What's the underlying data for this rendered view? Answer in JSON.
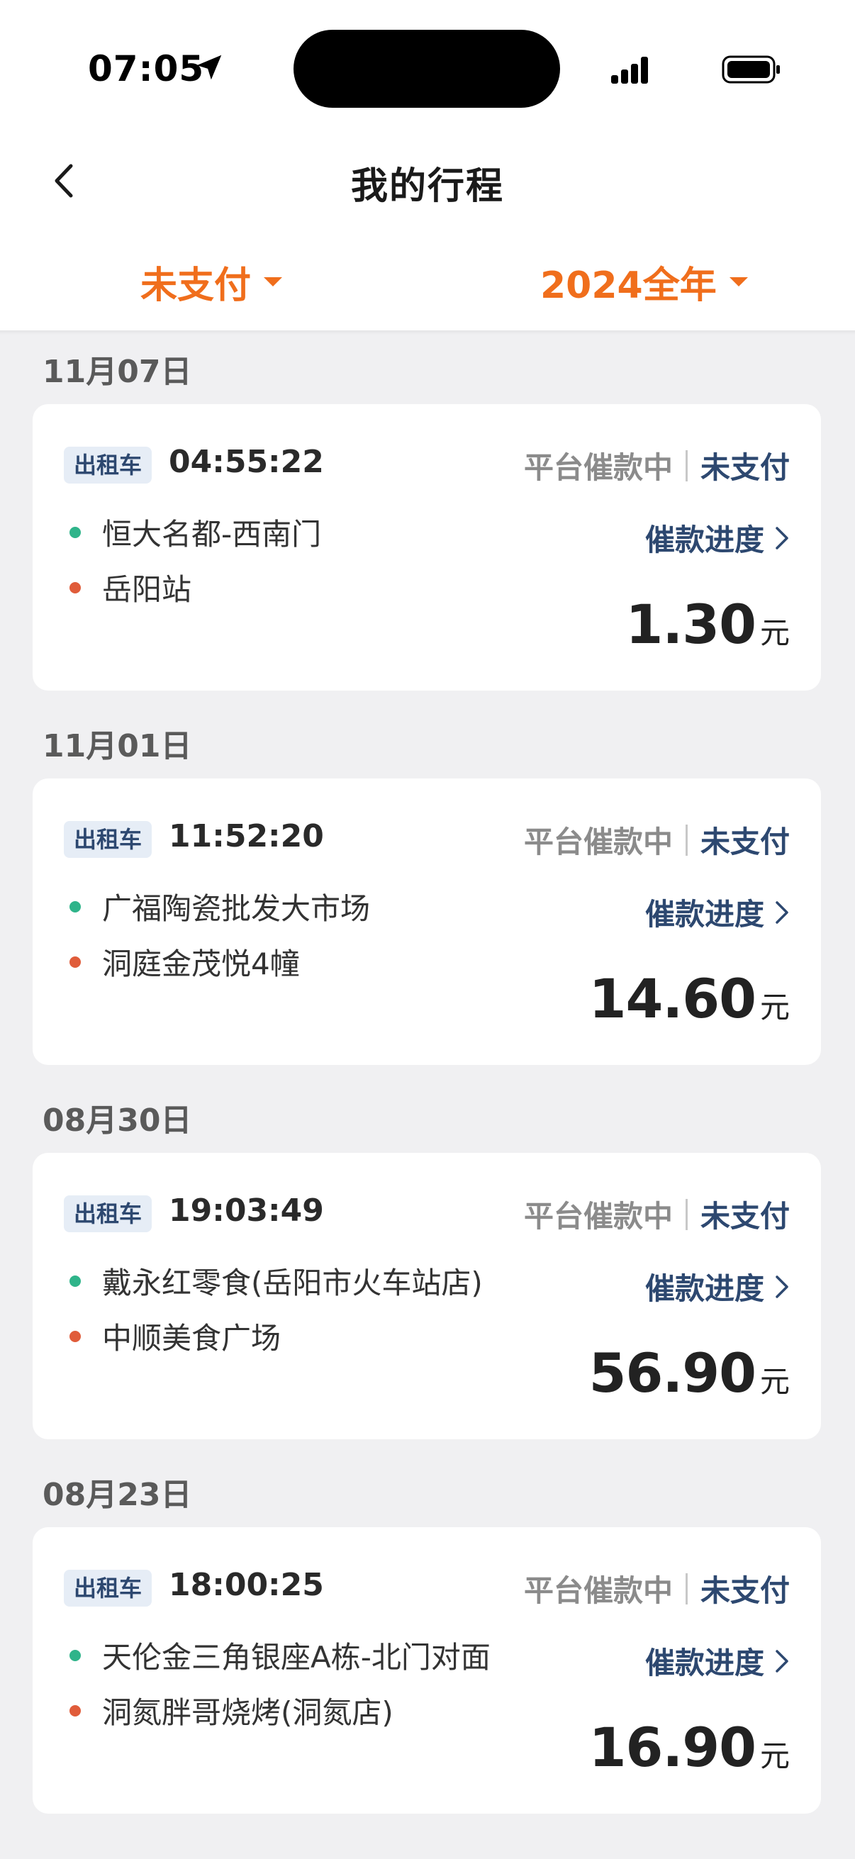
{
  "status_bar": {
    "time": "07:05"
  },
  "nav": {
    "title": "我的行程"
  },
  "filters": {
    "status": "未支付",
    "year": "2024全年"
  },
  "trips": [
    {
      "date": "11月07日",
      "type": "出租车",
      "time": "04:55:22",
      "platform_status": "平台催款中",
      "pay_status": "未支付",
      "from": "恒大名都-西南门",
      "to": "岳阳站",
      "progress_link": "催款进度",
      "amount": "1.30",
      "unit": "元"
    },
    {
      "date": "11月01日",
      "type": "出租车",
      "time": "11:52:20",
      "platform_status": "平台催款中",
      "pay_status": "未支付",
      "from": "广福陶瓷批发大市场",
      "to": "洞庭金茂悦4幢",
      "progress_link": "催款进度",
      "amount": "14.60",
      "unit": "元"
    },
    {
      "date": "08月30日",
      "type": "出租车",
      "time": "19:03:49",
      "platform_status": "平台催款中",
      "pay_status": "未支付",
      "from": "戴永红零食(岳阳市火车站店)",
      "to": "中顺美食广场",
      "progress_link": "催款进度",
      "amount": "56.90",
      "unit": "元"
    },
    {
      "date": "08月23日",
      "type": "出租车",
      "time": "18:00:25",
      "platform_status": "平台催款中",
      "pay_status": "未支付",
      "from": "天伦金三角银座A栋-北门对面",
      "to": "洞氮胖哥烧烤(洞氮店)",
      "progress_link": "催款进度",
      "amount": "16.90",
      "unit": "元"
    }
  ],
  "colors": {
    "accent": "#f06e1c",
    "link": "#2d4870",
    "start_dot": "#2fb48a",
    "end_dot": "#e05c3a"
  }
}
